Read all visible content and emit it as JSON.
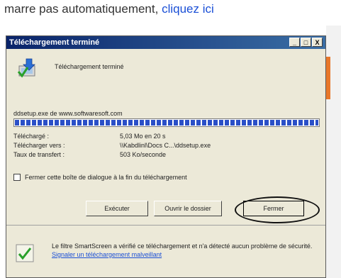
{
  "background": {
    "partial_text": "marre pas automatiquement,",
    "link_text": "cliquez ici"
  },
  "dialog": {
    "title": "Téléchargement terminé",
    "window_buttons": {
      "minimize": "_",
      "maximize": "□",
      "close": "X"
    },
    "header_text": "Téléchargement terminé",
    "source": "ddsetup.exe de www.softwaresoft.com",
    "progress": 1.0,
    "info": [
      {
        "label": "Téléchargé :",
        "value": "5,03 Mo en 20 s"
      },
      {
        "label": "Télécharger vers :",
        "value": "\\\\Kabdlinl\\Docs C...\\ddsetup.exe"
      },
      {
        "label": "Taux de transfert :",
        "value": "503 Ko/seconde"
      }
    ],
    "checkbox_label": "Fermer cette boîte de dialogue à la fin du téléchargement",
    "buttons": {
      "executer": "Exécuter",
      "ouvrir": "Ouvrir le dossier",
      "fermer": "Fermer"
    },
    "security_text": "Le filtre SmartScreen a vérifié ce téléchargement et n'a détecté aucun problème de sécurité.",
    "security_link": "Signaler un téléchargement malveillant"
  },
  "colors": {
    "titlebar": "#0a246a",
    "progress": "#2a4fc7",
    "link": "#1a4fd6"
  }
}
